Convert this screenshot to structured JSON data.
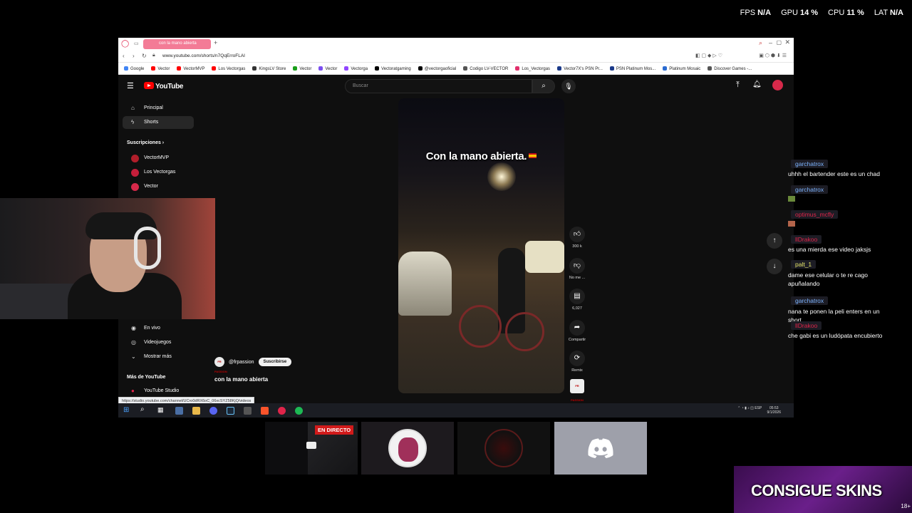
{
  "overlay_stats": {
    "fps_label": "FPS",
    "fps_value": "N/A",
    "gpu_label": "GPU",
    "gpu_value": "14 %",
    "cpu_label": "CPU",
    "cpu_value": "11 %",
    "lat_label": "LAT",
    "lat_value": "N/A"
  },
  "browser": {
    "tab_title": "con la mano abierta",
    "url": "www.youtube.com/shorts/n7QqErroFLAI",
    "bookmarks": [
      {
        "label": "Google",
        "color": "#4285f4"
      },
      {
        "label": "Vector",
        "color": "#ff0000"
      },
      {
        "label": "VectorMVP",
        "color": "#ff0000"
      },
      {
        "label": "Los Vectorgas",
        "color": "#ff0000"
      },
      {
        "label": "KingsLV Store",
        "color": "#333333"
      },
      {
        "label": "Vector",
        "color": "#1a9d1a"
      },
      {
        "label": "Vector",
        "color": "#7b4ef0"
      },
      {
        "label": "Vectorga",
        "color": "#9146ff"
      },
      {
        "label": "Vectoratgaming",
        "color": "#000000"
      },
      {
        "label": "@vectorgaoficial",
        "color": "#000000"
      },
      {
        "label": "Codigo LV-VECTOR",
        "color": "#555555"
      },
      {
        "label": "Los_Vectorgas",
        "color": "#e1306c"
      },
      {
        "label": "Vector7X's PSN Pr...",
        "color": "#1b3a8a"
      },
      {
        "label": "PSN Platinum Mos...",
        "color": "#1b3a8a"
      },
      {
        "label": "Platinum Mosaic",
        "color": "#2a6bd1"
      },
      {
        "label": "Discover Games -...",
        "color": "#555555"
      }
    ]
  },
  "youtube": {
    "logo_text": "YouTube",
    "search_placeholder": "Buscar",
    "sidebar": {
      "principal": "Principal",
      "shorts": "Shorts",
      "subscriptions_header": "Suscripciones",
      "subscriptions": [
        {
          "label": "VectorMVP",
          "color": "#b01e2a"
        },
        {
          "label": "Los Vectorgas",
          "color": "#c41e3a"
        },
        {
          "label": "Vector",
          "color": "#d6294a"
        }
      ],
      "live": "En vivo",
      "gaming": "Videojuegos",
      "show_more": "Mostrar más",
      "more_header": "Más de YouTube",
      "studio": "YouTube Studio"
    },
    "short": {
      "caption": "Con la mano abierta.",
      "channel_handle": "@frpassion",
      "channel_avatar_text": "FR PASSION",
      "subscribe_label": "Suscribirse",
      "title": "con la mano abierta",
      "actions": {
        "like_count": "300 k",
        "dislike_label": "No me ...",
        "comments_count": "6,027",
        "share_label": "Compartir",
        "remix_label": "Remix"
      }
    },
    "status_url": "https://studio.youtube.com/channel/UCro0dRX6oC_06xcSYZ58KjQ/videos"
  },
  "taskbar": {
    "tray_lang": "ESP",
    "time": "05:53",
    "date": "9/1/2026"
  },
  "chat": [
    {
      "user": "garchatrox",
      "user_color": "#7cb4ff",
      "text": "uhhh el bartender este es un chad"
    },
    {
      "user": "garchatrox",
      "user_color": "#7cb4ff",
      "text": ""
    },
    {
      "user": "optimus_mcfly",
      "user_color": "#e0244a",
      "text": ""
    },
    {
      "user": "llDrakoo",
      "user_color": "#e0244a",
      "text": "es una mierda ese video jaksjs"
    },
    {
      "user": "palt_1",
      "user_color": "#e8e86a",
      "text": "dame ese celular o te re cago apuñalando"
    },
    {
      "user": "garchatrox",
      "user_color": "#7cb4ff",
      "text": "nana te ponen la peli enters en un short"
    },
    {
      "user": "llDrakoo",
      "user_color": "#e0244a",
      "text": "che gabi es un ludópata encubierto"
    }
  ],
  "tiles": {
    "live_badge": "EN DIRECTO"
  },
  "banner": {
    "text": "CONSIGUE SKINS",
    "age": "18+"
  }
}
